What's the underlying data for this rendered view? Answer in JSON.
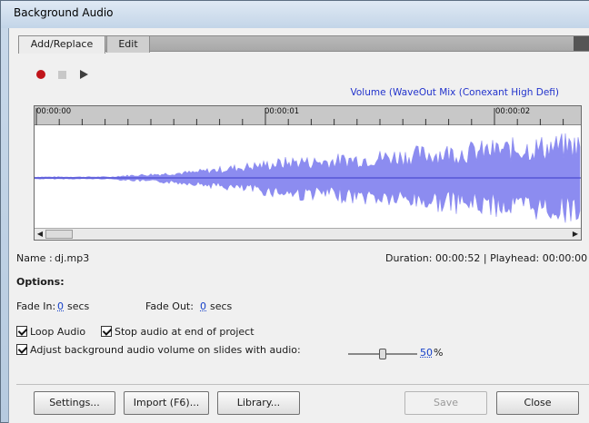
{
  "window": {
    "title": "Background Audio"
  },
  "tabs": [
    {
      "label": "Add/Replace"
    },
    {
      "label": "Edit"
    }
  ],
  "transport": {
    "record": "record-icon",
    "stop": "stop-icon",
    "play": "play-icon"
  },
  "volume_source": "Volume (WaveOut Mix (Conexant High Defi)",
  "timeline": {
    "markers": [
      "00:00:00",
      "00:00:01",
      "00:00:02"
    ]
  },
  "file": {
    "name_label": "Name :",
    "name_value": "dj.mp3"
  },
  "status": {
    "duration_label": "Duration:",
    "duration": "00:00:52",
    "separator": "|",
    "playhead_label": "Playhead:",
    "playhead": "00:00:00"
  },
  "options": {
    "heading": "Options:",
    "fade_in_label": "Fade In:",
    "fade_in_value": "0",
    "fade_in_unit": "secs",
    "fade_out_label": "Fade Out:",
    "fade_out_value": "0",
    "fade_out_unit": "secs",
    "loop_audio": {
      "label": "Loop Audio",
      "checked": true
    },
    "stop_audio": {
      "label": "Stop audio at end of project",
      "checked": true
    },
    "adjust_volume": {
      "label": "Adjust background audio volume on slides with audio:",
      "checked": true
    },
    "volume_value": "50",
    "volume_unit": "%",
    "volume_level": 0.5
  },
  "buttons": {
    "settings": "Settings...",
    "import": "Import (F6)...",
    "library": "Library...",
    "save": "Save",
    "close": "Close"
  },
  "colors": {
    "waveform": "#8c8cf0",
    "link": "#1540c8",
    "record": "#c0141a"
  }
}
